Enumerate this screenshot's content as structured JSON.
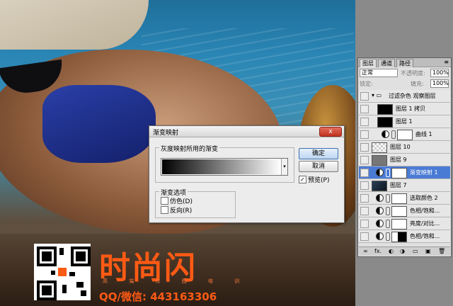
{
  "dialog": {
    "title": "渐变映射",
    "close_label": "x",
    "group_gray": "灰度映射所用的渐变",
    "gradient_arrow": "▾",
    "group_options": "渐变选项",
    "dither_label": "仿色(D)",
    "reverse_label": "反向(R)",
    "ok_label": "确定",
    "cancel_label": "取消",
    "preview_label": "预览(P)",
    "preview_checked": "✓"
  },
  "layers_panel": {
    "tabs": [
      "图层",
      "通道",
      "路径"
    ],
    "menu_glyph": "≡",
    "blend_mode": "正常",
    "opacity_label": "不透明度:",
    "opacity_value": "100%",
    "lock_label": "锁定:",
    "fill_label": "填充:",
    "fill_value": "100%",
    "layers": [
      {
        "name": "过滤杂色 观察图层",
        "kind": "group"
      },
      {
        "name": "图层 1 拷贝",
        "kind": "pixel"
      },
      {
        "name": "图层 1",
        "kind": "pixel"
      },
      {
        "name": "曲线 1",
        "kind": "adjust"
      },
      {
        "name": "图层 10",
        "kind": "pixel"
      },
      {
        "name": "图层 9",
        "kind": "pixel"
      },
      {
        "name": "渐变映射 1",
        "kind": "adjust",
        "selected": true
      },
      {
        "name": "图层 7",
        "kind": "pixel"
      },
      {
        "name": "选取颜色 2",
        "kind": "adjust"
      },
      {
        "name": "色相/饱和...",
        "kind": "adjust"
      },
      {
        "name": "亮度/对比...",
        "kind": "adjust"
      },
      {
        "name": "色相/饱和...",
        "kind": "adjust"
      }
    ],
    "bottom_icons": [
      "∞",
      "fx.",
      "◐",
      "◑",
      "▭",
      "▣",
      "🗑"
    ]
  },
  "watermark": {
    "brand": "时尚闪",
    "sub": "高 端 修 图 培 训",
    "qq": "QQ/微信:  443163306"
  },
  "colors": {
    "accent_orange": "#ff5a14",
    "selected_row": "#4a7bd4"
  }
}
